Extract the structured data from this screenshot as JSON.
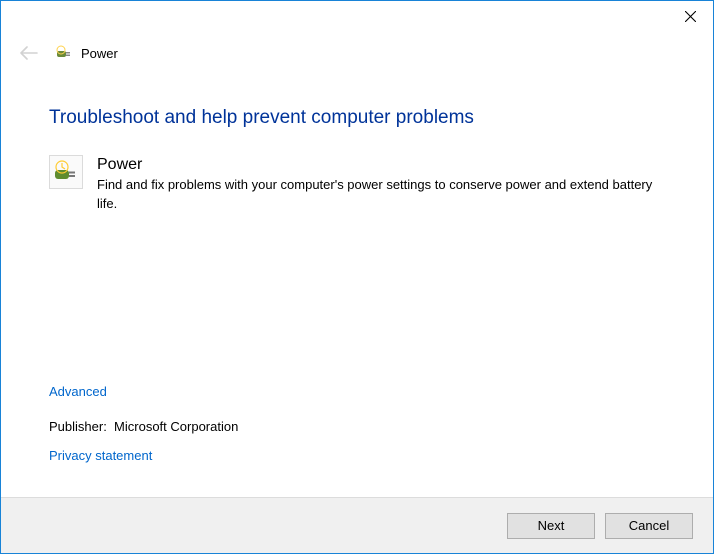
{
  "window": {
    "title": "Power"
  },
  "main": {
    "heading": "Troubleshoot and help prevent computer problems",
    "troubleshooter": {
      "name": "Power",
      "description": "Find and fix problems with your computer's power settings to conserve power and extend battery life."
    }
  },
  "links": {
    "advanced": "Advanced",
    "privacy": "Privacy statement"
  },
  "publisher": {
    "label": "Publisher:",
    "value": "Microsoft Corporation"
  },
  "footer": {
    "next": "Next",
    "cancel": "Cancel"
  }
}
